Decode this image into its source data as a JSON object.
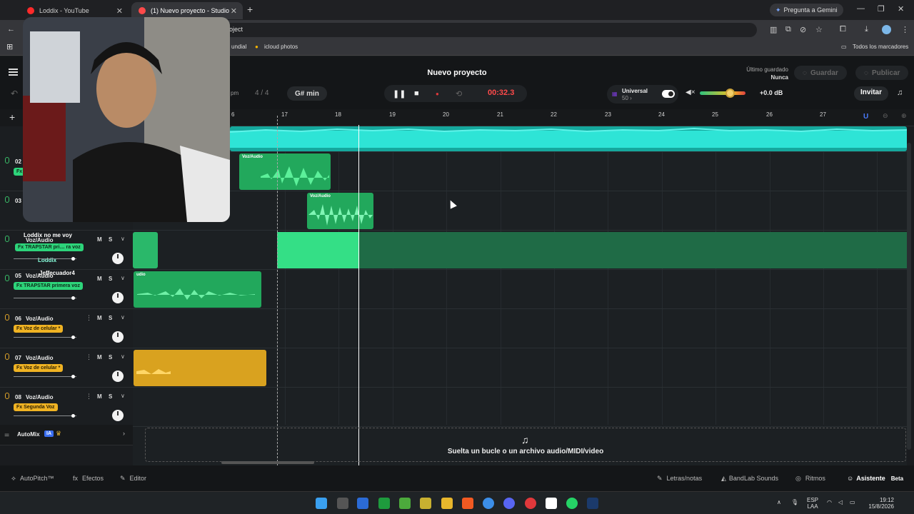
{
  "browser": {
    "tabs": [
      {
        "title": "Loddix - YouTube"
      },
      {
        "title": "(1) Nuevo proyecto - Studio"
      }
    ],
    "gemini_label": "Pregunta a Gemini",
    "url": "roject",
    "bookmarks": [
      "undial",
      "icloud photos"
    ],
    "all_bookmarks": "Todos los marcadores"
  },
  "header": {
    "project_title": "Nuevo proyecto",
    "last_saved_label": "Último guardado",
    "last_saved_value": "Nunca",
    "save_label": "Guardar",
    "publish_label": "Publicar",
    "bpm_label": "pm",
    "time_signature": "4 / 4",
    "key": "G# min",
    "time": "00:32.3",
    "universal_label": "Universal",
    "universal_value": "50 ›",
    "volume_db": "+0.0 dB",
    "invite_label": "Invitar"
  },
  "ruler": {
    "bars": [
      "6",
      "17",
      "18",
      "19",
      "20",
      "21",
      "22",
      "23",
      "24",
      "25",
      "26",
      "27"
    ]
  },
  "tracks": [
    {
      "num": "02",
      "name": "",
      "fx": "Fx",
      "color": "green"
    },
    {
      "num": "03",
      "name": "",
      "fx": "",
      "color": "green"
    },
    {
      "num": "",
      "name": "Voz/Audio",
      "overlay1": "Loddix no me voy",
      "overlay2": "Jeffecuador4",
      "fx": "Fx TRAPSTAR pri… ra voz",
      "overlay_user": "Loddix",
      "color": "green"
    },
    {
      "num": "05",
      "name": "Voz/Audio",
      "fx": "Fx TRAPSTAR primera voz",
      "color": "green"
    },
    {
      "num": "06",
      "name": "Voz/Audio",
      "fx": "Fx Voz de celular *",
      "color": "orange"
    },
    {
      "num": "07",
      "name": "Voz/Audio",
      "fx": "Fx Voz de celular *",
      "color": "orange"
    },
    {
      "num": "08",
      "name": "Voz/Audio",
      "fx": "Fx Segunda Voz",
      "color": "orange"
    }
  ],
  "clips": {
    "clip1_label": "Voz/Audio",
    "clip2_label": "Voz/Audio",
    "clip5_label": "udio"
  },
  "automix": {
    "label": "AutoMix",
    "badge": "IA"
  },
  "dropzone_text": "Suelta un bucle o un archivo audio/MIDI/video",
  "bottom": {
    "autopitch": "AutoPitch™",
    "effects": "Efectos",
    "editor": "Editor",
    "lyrics": "Letras/notas",
    "sounds": "BandLab Sounds",
    "rhythms": "Ritmos",
    "assistant": "Asistente",
    "beta": "Beta"
  },
  "taskbar": {
    "lang1": "ESP",
    "lang2": "LAA",
    "time": "19:12",
    "date": "15/8/2026"
  },
  "colors": {
    "teal": "#1fd1c4",
    "green": "#2dd47a",
    "orange": "#f0b323",
    "record_red": "#ff4a4a"
  }
}
